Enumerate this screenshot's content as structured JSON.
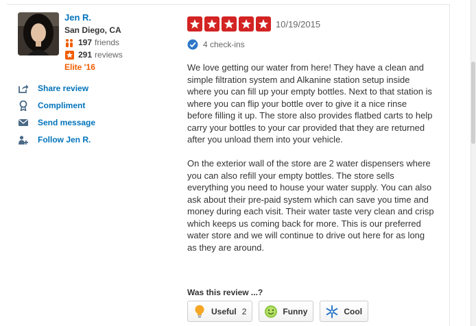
{
  "user": {
    "name": "Jen R.",
    "location": "San Diego, CA",
    "friends_count": "197",
    "friends_label": "friends",
    "reviews_count": "291",
    "reviews_label": "reviews",
    "elite": "Elite '16"
  },
  "actions": [
    {
      "label": "Share review",
      "icon": "share-icon"
    },
    {
      "label": "Compliment",
      "icon": "compliment-icon"
    },
    {
      "label": "Send message",
      "icon": "message-icon"
    },
    {
      "label": "Follow Jen R.",
      "icon": "follow-icon"
    }
  ],
  "review": {
    "rating": 5,
    "date": "10/19/2015",
    "checkins": "4 check-ins",
    "paragraphs": [
      "We love getting our water from here! They have a clean and simple filtration system and Alkanine station setup inside where you can fill up your empty bottles. Next to that station is where you can flip your bottle over to give it a nice rinse before filling it up. The store also provides flatbed carts to help carry your bottles to your car provided that they are returned after you unload them into your vehicle.",
      "On the exterior wall of the store are 2 water dispensers where you can also refill your empty bottles. The store sells everything you need to house your water supply. You can also ask about their pre-paid system which can save you time and money during each visit. Their water taste very clean and crisp which keeps us coming back for more. This is our preferred water store and we will continue to drive out here for as long as they are around."
    ]
  },
  "helpful": {
    "prompt": "Was this review ...?",
    "useful_label": "Useful",
    "useful_count": "2",
    "funny_label": "Funny",
    "cool_label": "Cool"
  },
  "colors": {
    "star_red": "#d32323",
    "link_blue": "#0073bb",
    "elite_orange": "#f15c00"
  }
}
